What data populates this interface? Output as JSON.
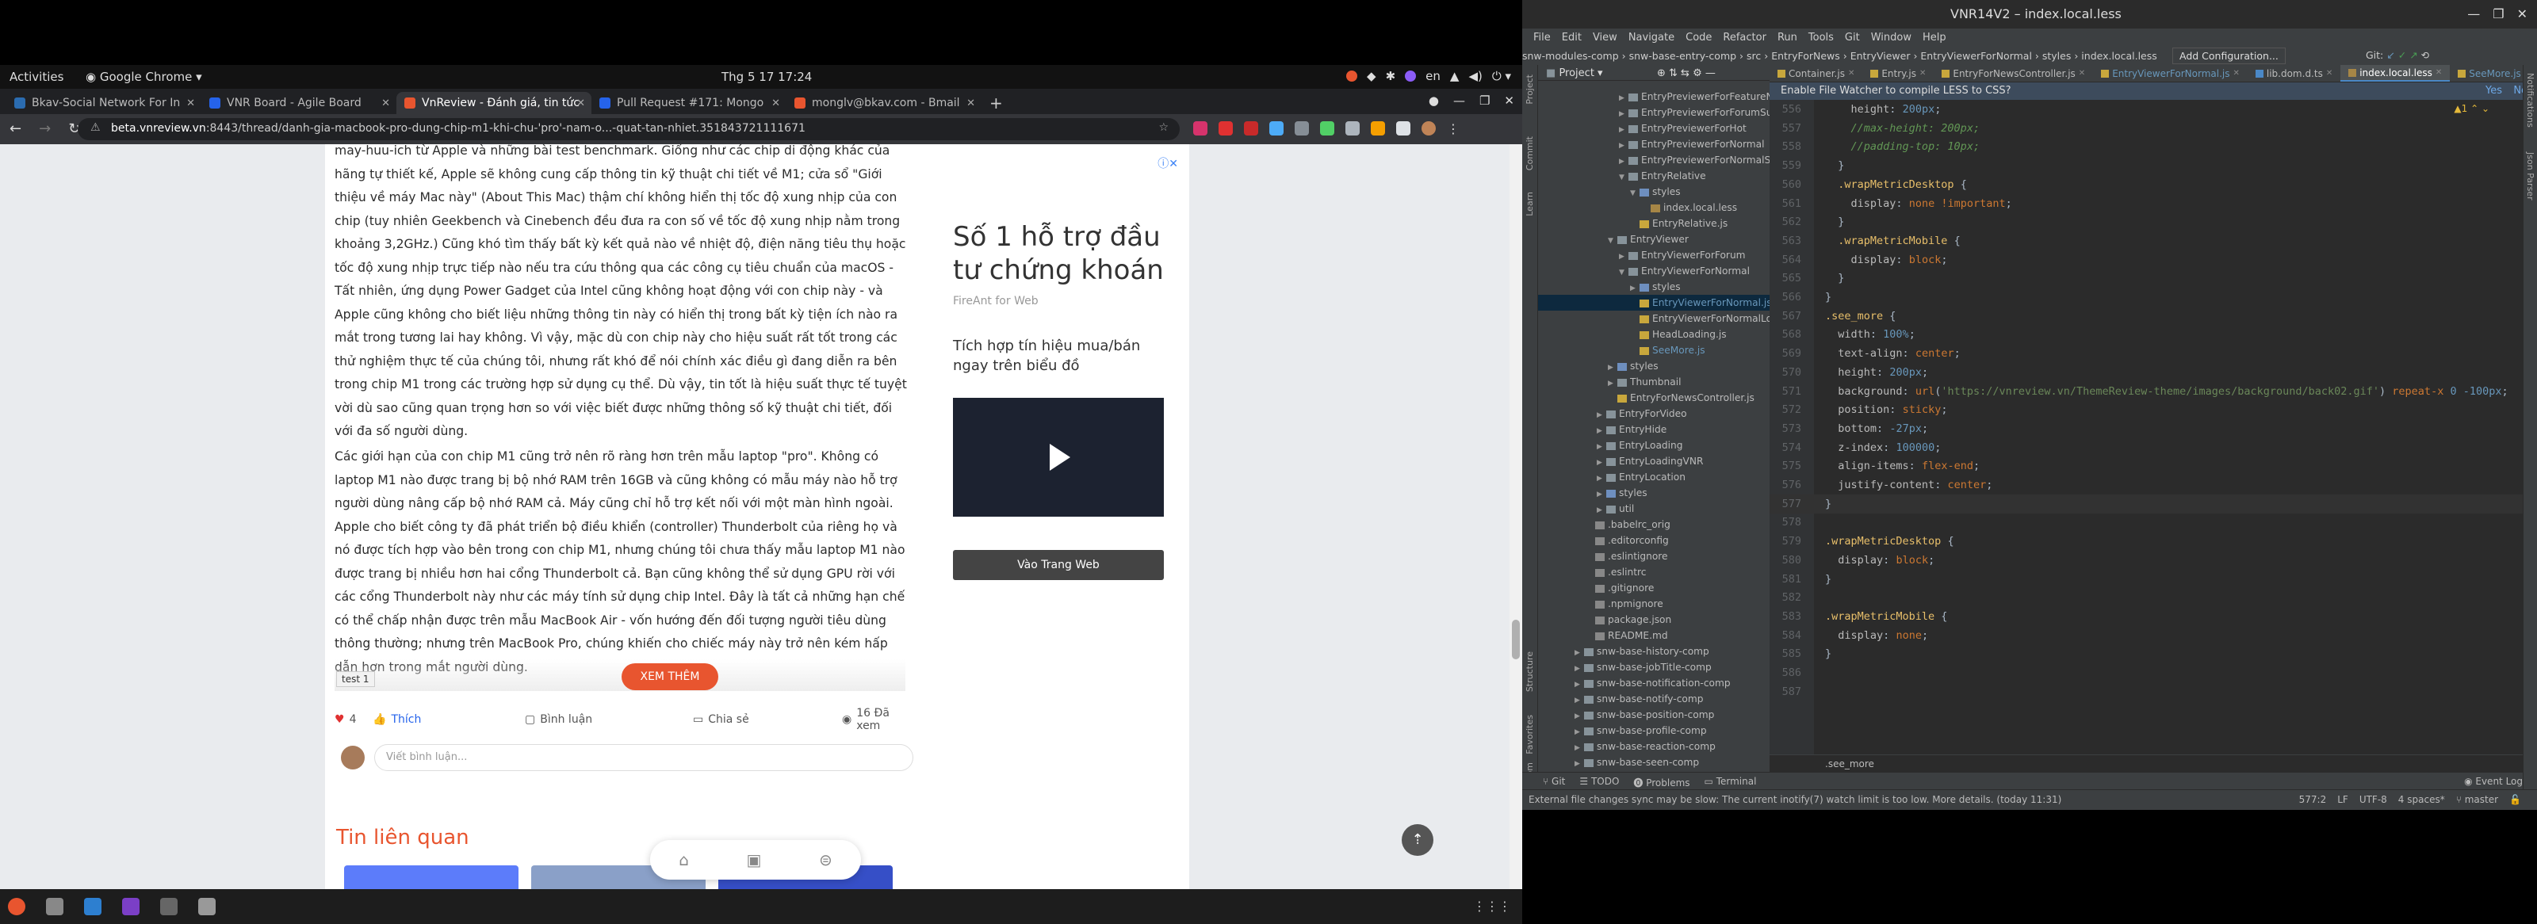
{
  "topbar": {
    "activities": "Activities",
    "app": "Google Chrome",
    "clock": "Thg 5 17  17:24",
    "lang": "en"
  },
  "chrome": {
    "tabs": [
      {
        "label": "Bkav-Social Network For In",
        "color": "#2b6cb0"
      },
      {
        "label": "VNR Board - Agile Board",
        "color": "#2563eb"
      },
      {
        "label": "VnReview - Đánh giá, tin tức",
        "color": "#e8552f"
      },
      {
        "label": "Pull Request #171: Mongo",
        "color": "#2563eb"
      },
      {
        "label": "monglv@bkav.com - Bmail",
        "color": "#e8552f"
      }
    ],
    "new_tab": "+",
    "url_host": "beta.vnreview.vn",
    "url_rest": ":8443/thread/danh-gia-macbook-pro-dung-chip-m1-khi-chu-'pro'-nam-o...-quat-tan-nhiet.351843721111671"
  },
  "article": {
    "p1": "may-huu-ich từ Apple và những bài test benchmark. Giống như các chip di động khác của hãng tự thiết kế, Apple sẽ không cung cấp thông tin kỹ thuật chi tiết về M1; cửa sổ \"Giới thiệu về máy Mac này\" (About This Mac) thậm chí không hiển thị tốc độ xung nhịp của con chip (tuy nhiên Geekbench và Cinebench đều đưa ra con số về tốc độ xung nhịp nằm trong khoảng 3,2GHz.) Cũng khó tìm thấy bất kỳ kết quả nào về nhiệt độ, điện năng tiêu thụ hoặc tốc độ xung nhịp trực tiếp nào nếu tra cứu thông qua các công cụ tiêu chuẩn của macOS - Tất nhiên, ứng dụng Power Gadget của Intel cũng không hoạt động với con chip này - và Apple cũng không cho biết liệu những thông tin này có hiển thị trong bất kỳ tiện ích nào ra mắt trong tương lai hay không. Vì vậy, mặc dù con chip này cho hiệu suất rất tốt trong các thử nghiệm thực tế của chúng tôi, nhưng rất khó để nói chính xác điều gì đang diễn ra bên trong chip M1 trong các trường hợp sử dụng cụ thể. Dù vậy, tin tốt là hiệu suất thực tế tuyệt vời dù sao cũng quan trọng hơn so với việc biết được những thông số kỹ thuật chi tiết, đối với đa số người dùng.",
    "p2": "Các giới hạn của con chip M1 cũng trở nên rõ ràng hơn trên mẫu laptop \"pro\". Không có laptop M1 nào được trang bị bộ nhớ RAM trên 16GB và cũng không có mẫu máy nào hỗ trợ người dùng nâng cấp bộ nhớ RAM cả. Máy cũng chỉ hỗ trợ kết nối với một màn hình ngoài. Apple cho biết công ty đã phát triển bộ điều khiển (controller) Thunderbolt của riêng họ và nó được tích hợp vào bên trong con chip M1, nhưng chúng tôi chưa thấy mẫu laptop M1 nào được trang bị nhiều hơn hai cổng Thunderbolt cả. Bạn cũng không thể sử dụng GPU rời với các cổng Thunderbolt này như các máy tính sử dụng chip Intel. Đây là tất cả những hạn chế có thể chấp nhận được trên mẫu MacBook Air - vốn hướng đến đối tượng người tiêu dùng thông thường; nhưng trên MacBook Pro, chúng khiến cho chiếc máy này trở nên kém hấp dẫn hơn trong mắt người dùng.",
    "see_more": "XEM THÊM",
    "tooltip": "test 1",
    "reactions_count": "4",
    "like": "Thích",
    "comment": "Bình luận",
    "share": "Chia sẻ",
    "views": "16 Đã xem",
    "comment_placeholder": "Viết bình luận...",
    "related_title": "Tin liên quan"
  },
  "ad": {
    "headline": "Số 1 hỗ trợ đầu tư chứng khoán",
    "brand": "FireAnt for Web",
    "desc": "Tích hợp tín hiệu mua/bán ngay trên biểu đồ",
    "cta": "Vào Trang Web"
  },
  "ide": {
    "title": "VNR14V2 – index.local.less",
    "menu": [
      "File",
      "Edit",
      "View",
      "Navigate",
      "Code",
      "Refactor",
      "Run",
      "Tools",
      "Git",
      "Window",
      "Help"
    ],
    "breadcrumb": "snw-modules-comp › snw-base-entry-comp › src › EntryForNews › EntryViewer › EntryViewerForNormal › styles › index.local.less",
    "run_config": "Add Configuration...",
    "git_label": "Git:",
    "project_label": "Project",
    "editor_tabs": [
      "Container.js",
      "Entry.js",
      "EntryForNewsController.js",
      "EntryViewerForNormal.js",
      "lib.dom.d.ts",
      "index.local.less",
      "SeeMore.js"
    ],
    "notify": "Enable File Watcher to compile LESS to CSS?",
    "notify_yes": "Yes",
    "notify_no": "No",
    "tree": [
      {
        "label": "EntryPreviewerForFeatureNormal",
        "indent": 3,
        "kind": "fold",
        "arrow": "▶"
      },
      {
        "label": "EntryPreviewerForForumSummary",
        "indent": 3,
        "kind": "fold",
        "arrow": "▶"
      },
      {
        "label": "EntryPreviewerForHot",
        "indent": 3,
        "kind": "fold",
        "arrow": "▶"
      },
      {
        "label": "EntryPreviewerForNormal",
        "indent": 3,
        "kind": "fold",
        "arrow": "▶"
      },
      {
        "label": "EntryPreviewerForNormalSmall",
        "indent": 3,
        "kind": "fold",
        "arrow": "▶"
      },
      {
        "label": "EntryRelative",
        "indent": 3,
        "kind": "fold",
        "arrow": "▼"
      },
      {
        "label": "styles",
        "indent": 4,
        "kind": "fstyl",
        "arrow": "▼"
      },
      {
        "label": "index.local.less",
        "indent": 5,
        "kind": "less",
        "arrow": ""
      },
      {
        "label": "EntryRelative.js",
        "indent": 4,
        "kind": "js",
        "arrow": ""
      },
      {
        "label": "EntryViewer",
        "indent": 2,
        "kind": "fold",
        "arrow": "▼"
      },
      {
        "label": "EntryViewerForForum",
        "indent": 3,
        "kind": "fold",
        "arrow": "▶"
      },
      {
        "label": "EntryViewerForNormal",
        "indent": 3,
        "kind": "fold",
        "arrow": "▼"
      },
      {
        "label": "styles",
        "indent": 4,
        "kind": "fstyl",
        "arrow": "▶"
      },
      {
        "label": "EntryViewerForNormal.js",
        "indent": 4,
        "kind": "js",
        "arrow": "",
        "selected": true,
        "blue": true
      },
      {
        "label": "EntryViewerForNormalLoading.js",
        "indent": 4,
        "kind": "js",
        "arrow": ""
      },
      {
        "label": "HeadLoading.js",
        "indent": 4,
        "kind": "js",
        "arrow": ""
      },
      {
        "label": "SeeMore.js",
        "indent": 4,
        "kind": "js",
        "arrow": "",
        "blue": true
      },
      {
        "label": "styles",
        "indent": 2,
        "kind": "fstyl",
        "arrow": "▶"
      },
      {
        "label": "Thumbnail",
        "indent": 2,
        "kind": "fold",
        "arrow": "▶"
      },
      {
        "label": "EntryForNewsController.js",
        "indent": 2,
        "kind": "js",
        "arrow": ""
      },
      {
        "label": "EntryForVideo",
        "indent": 1,
        "kind": "fold",
        "arrow": "▶"
      },
      {
        "label": "EntryHide",
        "indent": 1,
        "kind": "fold",
        "arrow": "▶"
      },
      {
        "label": "EntryLoading",
        "indent": 1,
        "kind": "fold",
        "arrow": "▶"
      },
      {
        "label": "EntryLoadingVNR",
        "indent": 1,
        "kind": "fold",
        "arrow": "▶"
      },
      {
        "label": "EntryLocation",
        "indent": 1,
        "kind": "fold",
        "arrow": "▶"
      },
      {
        "label": "styles",
        "indent": 1,
        "kind": "fstyl",
        "arrow": "▶"
      },
      {
        "label": "util",
        "indent": 1,
        "kind": "fold",
        "arrow": "▶"
      },
      {
        "label": ".babelrc_orig",
        "indent": 0,
        "kind": "cfgf",
        "arrow": ""
      },
      {
        "label": ".editorconfig",
        "indent": 0,
        "kind": "cfgf",
        "arrow": ""
      },
      {
        "label": ".eslintignore",
        "indent": 0,
        "kind": "cfgf",
        "arrow": ""
      },
      {
        "label": ".eslintrc",
        "indent": 0,
        "kind": "cfgf",
        "arrow": ""
      },
      {
        "label": ".gitignore",
        "indent": 0,
        "kind": "cfgf",
        "arrow": ""
      },
      {
        "label": ".npmignore",
        "indent": 0,
        "kind": "cfgf",
        "arrow": ""
      },
      {
        "label": "package.json",
        "indent": 0,
        "kind": "cfgf",
        "arrow": ""
      },
      {
        "label": "README.md",
        "indent": 0,
        "kind": "cfgf",
        "arrow": ""
      },
      {
        "label": "snw-base-history-comp",
        "indent": -1,
        "kind": "fold",
        "arrow": "▶"
      },
      {
        "label": "snw-base-jobTitle-comp",
        "indent": -1,
        "kind": "fold",
        "arrow": "▶"
      },
      {
        "label": "snw-base-notification-comp",
        "indent": -1,
        "kind": "fold",
        "arrow": "▶"
      },
      {
        "label": "snw-base-notify-comp",
        "indent": -1,
        "kind": "fold",
        "arrow": "▶"
      },
      {
        "label": "snw-base-position-comp",
        "indent": -1,
        "kind": "fold",
        "arrow": "▶"
      },
      {
        "label": "snw-base-profile-comp",
        "indent": -1,
        "kind": "fold",
        "arrow": "▶"
      },
      {
        "label": "snw-base-reaction-comp",
        "indent": -1,
        "kind": "fold",
        "arrow": "▶"
      },
      {
        "label": "snw-base-seen-comp",
        "indent": -1,
        "kind": "fold",
        "arrow": "▶"
      }
    ],
    "code": [
      {
        "n": "556",
        "html": "    <span class='pr'>height</span>: <span class='num'>200px</span>;"
      },
      {
        "n": "557",
        "html": "    <span class='cm'>//max-height: 200px;</span>"
      },
      {
        "n": "558",
        "html": "    <span class='cm'>//padding-top: 10px;</span>"
      },
      {
        "n": "559",
        "html": "  }"
      },
      {
        "n": "560",
        "html": "  <span class='sel'>.wrapMetricDesktop</span> {"
      },
      {
        "n": "561",
        "html": "    <span class='pr'>display</span>: <span class='kw'>none</span> <span class='kw'>!important</span>;"
      },
      {
        "n": "562",
        "html": "  }"
      },
      {
        "n": "563",
        "html": "  <span class='sel'>.wrapMetricMobile</span> {"
      },
      {
        "n": "564",
        "html": "    <span class='pr'>display</span>: <span class='kw'>block</span>;"
      },
      {
        "n": "565",
        "html": "  }"
      },
      {
        "n": "566",
        "html": "}"
      },
      {
        "n": "567",
        "html": "<span class='sel'>.see_more</span> {"
      },
      {
        "n": "568",
        "html": "  <span class='pr'>width</span>: <span class='num'>100%</span>;"
      },
      {
        "n": "569",
        "html": "  <span class='pr'>text-align</span>: <span class='kw'>center</span>;"
      },
      {
        "n": "570",
        "html": "  <span class='pr'>height</span>: <span class='num'>200px</span>;"
      },
      {
        "n": "571",
        "html": "  <span class='pr'>background</span>: <span class='kw'>url</span>(<span class='str'>'https://vnreview.vn/ThemeReview-theme/images/background/back02.gif'</span>) <span class='kw'>repeat-x</span> <span class='num'>0</span> <span class='num'>-100px</span>;"
      },
      {
        "n": "572",
        "html": "  <span class='pr'>position</span>: <span class='kw'>sticky</span>;"
      },
      {
        "n": "573",
        "html": "  <span class='pr'>bottom</span>: <span class='num'>-27px</span>;"
      },
      {
        "n": "574",
        "html": "  <span class='pr'>z-index</span>: <span class='num'>100000</span>;"
      },
      {
        "n": "575",
        "html": "  <span class='pr'>align-items</span>: <span class='kw'>flex-end</span>;"
      },
      {
        "n": "576",
        "html": "  <span class='pr'>justify-content</span>: <span class='kw'>center</span>;"
      },
      {
        "n": "577",
        "html": "}",
        "cur": true
      },
      {
        "n": "578",
        "html": ""
      },
      {
        "n": "579",
        "html": "<span class='sel'>.wrapMetricDesktop</span> {"
      },
      {
        "n": "580",
        "html": "  <span class='pr'>display</span>: <span class='kw'>block</span>;"
      },
      {
        "n": "581",
        "html": "}"
      },
      {
        "n": "582",
        "html": ""
      },
      {
        "n": "583",
        "html": "<span class='sel'>.wrapMetricMobile</span> {"
      },
      {
        "n": "584",
        "html": "  <span class='pr'>display</span>: <span class='kw'>none</span>;"
      },
      {
        "n": "585",
        "html": "}"
      },
      {
        "n": "586",
        "html": ""
      },
      {
        "n": "587",
        "html": ""
      }
    ],
    "editor_crumb": ".see_more",
    "toolwindows": [
      "Git",
      "TODO",
      "Problems",
      "Terminal"
    ],
    "event_log": "Event Log",
    "status_msg": "External file changes sync may be slow: The current inotify(7) watch limit is too low. More details. (today 11:31)",
    "status_right": [
      "577:2",
      "LF",
      "UTF-8",
      "4 spaces*",
      "master"
    ],
    "left_strip_labels": [
      "Project",
      "Commit",
      "Learn"
    ],
    "bottom_strip_labels": [
      "Structure",
      "Favorites",
      "npm"
    ],
    "right_strip_labels": [
      "Notifications",
      "Json Parser"
    ]
  }
}
